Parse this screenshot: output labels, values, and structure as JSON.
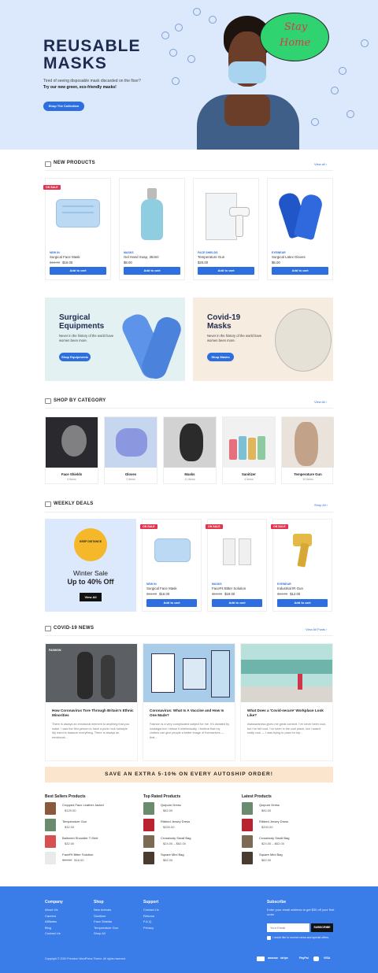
{
  "hero": {
    "title_line1": "REUSABLE",
    "title_line2": "MASKS",
    "text1": "Tired of seeing disposable mask discarded on the floor?",
    "text2": "Try our new green, eco-friendly masks!",
    "cta": "Shop The Collection",
    "bubble_line1": "Stay",
    "bubble_line2": "Home"
  },
  "new_products": {
    "title": "NEW PRODUCTS",
    "view_all": "View all",
    "items": [
      {
        "badge": "ON SALE",
        "category": "NEW IN",
        "name": "Surgical Face Mask",
        "old": "$18.00",
        "price": "$16.00",
        "button": "Add to cart"
      },
      {
        "badge": "",
        "category": "MASKS",
        "name": "Gel Hand Soap, 354ml",
        "old": "",
        "price": "$8.00",
        "button": "Add to cart"
      },
      {
        "badge": "",
        "category": "FACE SHIELDS",
        "name": "Temperature Gun",
        "old": "",
        "price": "$20.00",
        "button": "Add to cart"
      },
      {
        "badge": "",
        "category": "EYEWEAR",
        "name": "Surgical Latex Gloves",
        "old": "",
        "price": "$5.00",
        "button": "Add to cart"
      }
    ]
  },
  "promos": [
    {
      "title1": "Surgical",
      "title2": "Equipments",
      "text": "Never in the history of the world have women been more.",
      "button": "Shop Equipments"
    },
    {
      "title1": "Covid-19",
      "title2": "Masks",
      "text": "Never in the history of the world have women been more.",
      "button": "Shop Masks"
    }
  ],
  "categories": {
    "title": "SHOP BY CATEGORY",
    "view_all": "View All",
    "items": [
      {
        "name": "Face Shields",
        "count": "4 Items"
      },
      {
        "name": "Gloves",
        "count": "2 Items"
      },
      {
        "name": "Masks",
        "count": "11 Items"
      },
      {
        "name": "Sanitizer",
        "count": "4 Items"
      },
      {
        "name": "Temperature Gun",
        "count": "10 Items"
      }
    ]
  },
  "weekly": {
    "title": "WEEKLY DEALS",
    "view_all": "Shop All",
    "promo_line1": "Winter Sale",
    "promo_line2": "Up to 40% Off",
    "promo_button": "View All",
    "seal_text": "KEEP DISTANCE",
    "items": [
      {
        "badge": "ON SALE",
        "category": "NEW IN",
        "name": "Surgical Face Mask",
        "old": "$24.00",
        "price": "$16.00",
        "button": "Add to cart"
      },
      {
        "badge": "ON SALE",
        "category": "MASKS",
        "name": "FaceFit Bitter Solution",
        "old": "$24.00",
        "price": "$18.00",
        "button": "Add to cart"
      },
      {
        "badge": "ON SALE",
        "category": "EYEWEAR",
        "name": "Industrial IR Gun",
        "old": "$24.00",
        "price": "$12.00",
        "button": "Add to cart"
      }
    ]
  },
  "news": {
    "title": "COVID-19 NEWS",
    "view_all": "View All Posts",
    "items": [
      {
        "tag": "FASHION",
        "title": "How Coronavirus Tore Through Britain's Ethnic Minorities",
        "excerpt": "There is always an emotional element to anything that you make. I was the first person to have a punk rock hairstyle. My hand to balance everything. There is always an emotional..."
      },
      {
        "tag": "",
        "title": "Coronavirus: What Is A Vaccine and How Is One Made?",
        "excerpt": "Fashion is a very complicated subject for me. It's dictated by nostalgia but I refuse it intellectually. I believe that my clothes can give people a better image of themselves — that..."
      },
      {
        "tag": "",
        "title": "What Does a 'Covid-secure' Workplace Look Like?",
        "excerpt": "Awkwardness gives me great comfort. I've never been cool, but I've felt cool. I've been in the cool place, but I wasn't really cool — I was trying to pass for hip..."
      }
    ]
  },
  "autoship": "SAVE AN EXTRA 5-10% ON EVERY AUTOSHIP ORDER!",
  "lists": [
    {
      "title": "Best Sellers Products",
      "items": [
        {
          "name": "Cropped Faux Leather Jacket",
          "old": "",
          "price": "$129.00"
        },
        {
          "name": "Temperature Gun",
          "old": "",
          "price": "$32.00"
        },
        {
          "name": "Balloned Shoulder T-Shirt",
          "old": "",
          "price": "$32.00"
        },
        {
          "name": "FaceFit Bitter Solution",
          "old": "$24.50",
          "price": "$18.00"
        }
      ]
    },
    {
      "title": "Top Rated Products",
      "items": [
        {
          "name": "Quipure Dress",
          "old": "",
          "price": "$82.00"
        },
        {
          "name": "Ribbed Jersey Dress",
          "old": "",
          "price": "$200.00"
        },
        {
          "name": "Crossbody Small Bag",
          "old": "",
          "price": "$24.00 – $62.00"
        },
        {
          "name": "Square Mini Bag",
          "old": "",
          "price": "$62.00"
        }
      ]
    },
    {
      "title": "Latest Products",
      "items": [
        {
          "name": "Quipure Dress",
          "old": "",
          "price": "$82.00"
        },
        {
          "name": "Ribbed Jersey Dress",
          "old": "",
          "price": "$200.00"
        },
        {
          "name": "Crossbody Small Bag",
          "old": "",
          "price": "$24.00 – $62.00"
        },
        {
          "name": "Square Mini Bag",
          "old": "",
          "price": "$62.00"
        }
      ]
    }
  ],
  "footer": {
    "company": {
      "title": "Company",
      "links": [
        "About Us",
        "Careers",
        "Affiliates",
        "Blog",
        "Contact Us"
      ]
    },
    "shop": {
      "title": "Shop",
      "links": [
        "New Arrivals",
        "Sanitizer",
        "Face Shields",
        "Temperature Gun",
        "Shop All"
      ]
    },
    "support": {
      "title": "Support",
      "links": [
        "Contact Us",
        "Returns",
        "F.A.Q.",
        "Privacy"
      ]
    },
    "subscribe": {
      "title": "Subscribe",
      "text": "Enter your email address to get $30 off your first order",
      "placeholder": "Your Email",
      "button": "SUBSCRIBE",
      "consent": "I would like to receive news and special offers."
    },
    "copyright": "Copyright © 2020 Premium WordPress Theme. All rights reserved.",
    "payments": [
      "amazon",
      "stripe",
      "PayPal",
      "VISA"
    ]
  },
  "colors": {
    "accent": "#2d6fdf",
    "hero_bg": "#dce8fb",
    "sale": "#e2344f",
    "footer": "#3b7de8",
    "autoship_bg": "#fbe6cd"
  }
}
